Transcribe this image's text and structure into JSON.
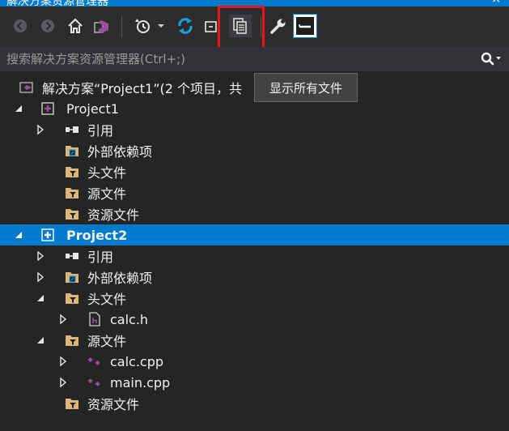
{
  "window": {
    "title": "解决方案资源管理器",
    "close_glyph": "×"
  },
  "toolbar": {
    "icons": [
      "back-icon",
      "forward-icon",
      "home-icon",
      "vs-switch-view-icon",
      "history-icon",
      "dropdown-arrow-icon",
      "sync-icon",
      "collapse-all-icon",
      "show-all-files-icon",
      "properties-wrench-icon",
      "preview-selected-icon"
    ]
  },
  "search": {
    "placeholder": "搜索解决方案资源管理器(Ctrl+;)"
  },
  "tooltip": {
    "text": "显示所有文件"
  },
  "tree": {
    "solution": "解决方案“Project1”(2 个项目，共",
    "project1": {
      "name": "Project1",
      "items": [
        "引用",
        "外部依赖项",
        "头文件",
        "源文件",
        "资源文件"
      ]
    },
    "project2": {
      "name": "Project2",
      "references": "引用",
      "external": "外部依赖项",
      "headers": "头文件",
      "header_files": [
        "calc.h"
      ],
      "sources": "源文件",
      "source_files": [
        "calc.cpp",
        "main.cpp"
      ],
      "resources": "资源文件"
    }
  },
  "colors": {
    "accent": "#007acc",
    "background": "#252526",
    "toolbar": "#2d2d30",
    "highlight": "#e8141c",
    "filter": "#dcb67a",
    "vs_purple": "#9b4f96"
  }
}
